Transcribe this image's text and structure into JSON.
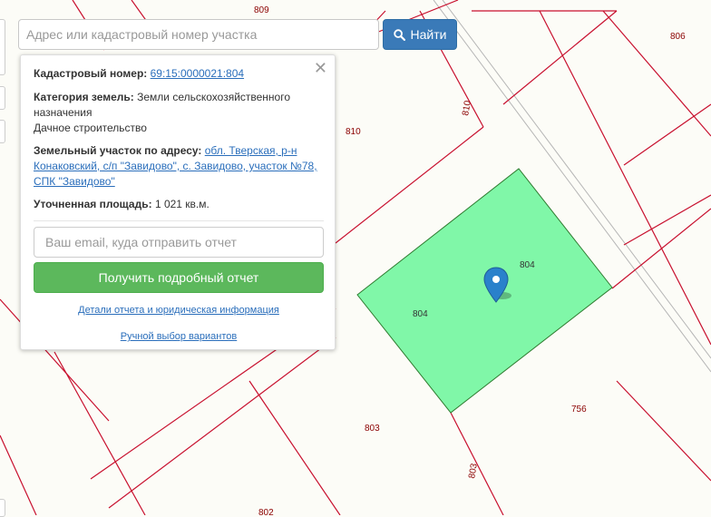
{
  "search": {
    "placeholder": "Адрес или кадастровый номер участка",
    "button_label": "Найти",
    "button_icon": "search-icon"
  },
  "popup": {
    "close_symbol": "✕",
    "cadastral_label": "Кадастровый номер:",
    "cadastral_value": "69:15:0000021:804",
    "category_label": "Категория земель:",
    "category_value": "Земли сельскохозяйственного назначения",
    "usage_value": "Дачное строительство",
    "address_label": "Земельный участок по адресу:",
    "address_value": "обл. Тверская, р-н Конаковский, с/п \"Завидово\", с. Завидово, участок №78, СПК \"Завидово\"",
    "area_label": "Уточненная площадь:",
    "area_value": "1 021 кв.м.",
    "email_placeholder": "Ваш email, куда отправить отчет",
    "report_button": "Получить подробный отчет",
    "details_link": "Детали отчета и юридическая информация",
    "manual_link": "Ручной выбор вариантов"
  },
  "map": {
    "colors": {
      "background": "#fcfcf7",
      "boundary": "#c8102e",
      "selected_fill": "#80f7a8",
      "selected_stroke": "#2f7a2f",
      "marker": "#2a81cb",
      "road": "#b5b5b5"
    },
    "labels": {
      "p809": "809",
      "p806": "806",
      "p810": "810",
      "p810b": "810",
      "p804a": "804",
      "p804b": "804",
      "p756": "756",
      "p803": "803",
      "p803b": "803",
      "p802": "802"
    }
  }
}
